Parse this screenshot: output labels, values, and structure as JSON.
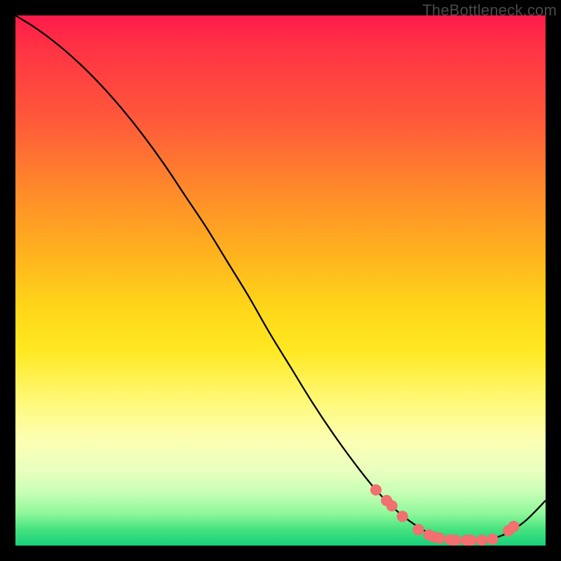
{
  "watermark": "TheBottleneck.com",
  "colors": {
    "background": "#000000",
    "curve": "#000000",
    "marker": "#f27070"
  },
  "chart_data": {
    "type": "line",
    "title": "",
    "xlabel": "",
    "ylabel": "",
    "xlim": [
      0,
      100
    ],
    "ylim": [
      0,
      100
    ],
    "x": [
      0,
      4,
      8,
      12,
      16,
      20,
      24,
      28,
      32,
      36,
      40,
      44,
      48,
      52,
      56,
      60,
      64,
      68,
      72,
      76,
      80,
      84,
      88,
      92,
      96,
      100
    ],
    "values": [
      100,
      97.5,
      94.5,
      91,
      87,
      82.5,
      77.5,
      72,
      66,
      60,
      53.5,
      47,
      40,
      33.5,
      27,
      21,
      15.5,
      10.5,
      6.5,
      3.5,
      1.5,
      1,
      1,
      2,
      4.5,
      8.5
    ],
    "markers_x": [
      68,
      70,
      71,
      73,
      76,
      78,
      79,
      80,
      82,
      83,
      85,
      86,
      88,
      90,
      93,
      94
    ],
    "markers_y": [
      10.5,
      8.5,
      7.5,
      5.5,
      3.0,
      2.0,
      1.6,
      1.4,
      1.1,
      1.0,
      1.0,
      1.0,
      1.0,
      1.2,
      2.8,
      3.6
    ]
  }
}
